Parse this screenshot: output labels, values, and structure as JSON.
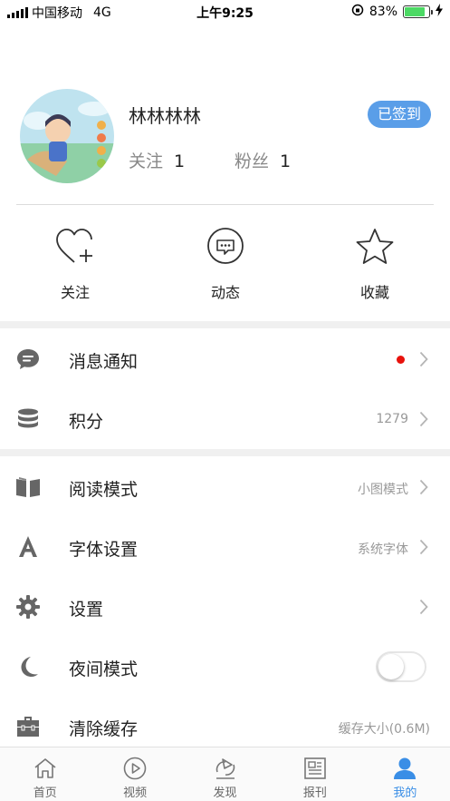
{
  "status_bar": {
    "carrier": "中国移动",
    "network": "4G",
    "time": "上午9:25",
    "battery": "83%",
    "battery_level": 0.83
  },
  "profile": {
    "username": "林林林林",
    "signed_label": "已签到",
    "follow_label": "关注",
    "follow_count": "1",
    "fans_label": "粉丝",
    "fans_count": "1"
  },
  "shortcuts": [
    {
      "label": "关注",
      "icon": "heart-plus-icon"
    },
    {
      "label": "动态",
      "icon": "chat-bubble-icon"
    },
    {
      "label": "收藏",
      "icon": "star-icon"
    }
  ],
  "menu": {
    "notifications": {
      "label": "消息通知",
      "icon": "message-icon",
      "has_unread_dot": true
    },
    "points": {
      "label": "积分",
      "value": "1279",
      "icon": "coins-icon"
    },
    "reading_mode": {
      "label": "阅读模式",
      "value": "小图模式",
      "icon": "book-icon"
    },
    "font_settings": {
      "label": "字体设置",
      "value": "系统字体",
      "icon": "font-icon"
    },
    "settings": {
      "label": "设置",
      "icon": "gear-icon"
    },
    "night_mode": {
      "label": "夜间模式",
      "icon": "moon-icon",
      "enabled": false
    },
    "clear_cache": {
      "label": "清除缓存",
      "value": "缓存大小(0.6M)",
      "icon": "toolbox-icon"
    }
  },
  "tabbar": [
    {
      "label": "首页",
      "icon": "home-icon",
      "active": false
    },
    {
      "label": "视频",
      "icon": "play-icon",
      "active": false
    },
    {
      "label": "发现",
      "icon": "discover-icon",
      "active": false
    },
    {
      "label": "报刊",
      "icon": "newspaper-icon",
      "active": false
    },
    {
      "label": "我的",
      "icon": "user-icon",
      "active": true
    }
  ],
  "colors": {
    "accent": "#3a8ee6",
    "signed_button": "#5a9ee8",
    "unread_dot": "#e8120c",
    "battery": "#4cd964"
  }
}
